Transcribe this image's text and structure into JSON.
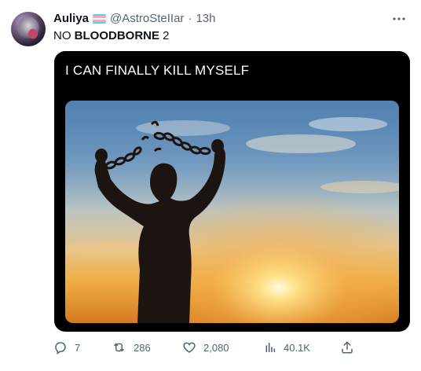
{
  "author": {
    "display_name": "Auliya",
    "handle": "@AstroSteIIar",
    "separator": "·",
    "time": "13h",
    "flag_colors": [
      "#5bcefa",
      "#f5a9b8",
      "#ffffff",
      "#f5a9b8",
      "#5bcefa"
    ]
  },
  "tweet": {
    "text_prefix": "NO ",
    "text_bold": "BLOODBORNE",
    "text_suffix": " 2"
  },
  "media": {
    "caption": "I CAN FINALLY KILL MYSELF",
    "photo_subject": "silhouette of a man breaking chains against a sunset sky"
  },
  "actions": {
    "replies": "7",
    "reposts": "286",
    "likes": "2,080",
    "views": "40.1K"
  },
  "icons": {
    "more": "more-dots-icon",
    "reply": "reply-icon",
    "repost": "repost-icon",
    "like": "heart-icon",
    "views": "views-chart-icon",
    "share": "share-icon"
  },
  "colors": {
    "text": "#0f1419",
    "secondary": "#536471",
    "media_background": "#000000"
  }
}
